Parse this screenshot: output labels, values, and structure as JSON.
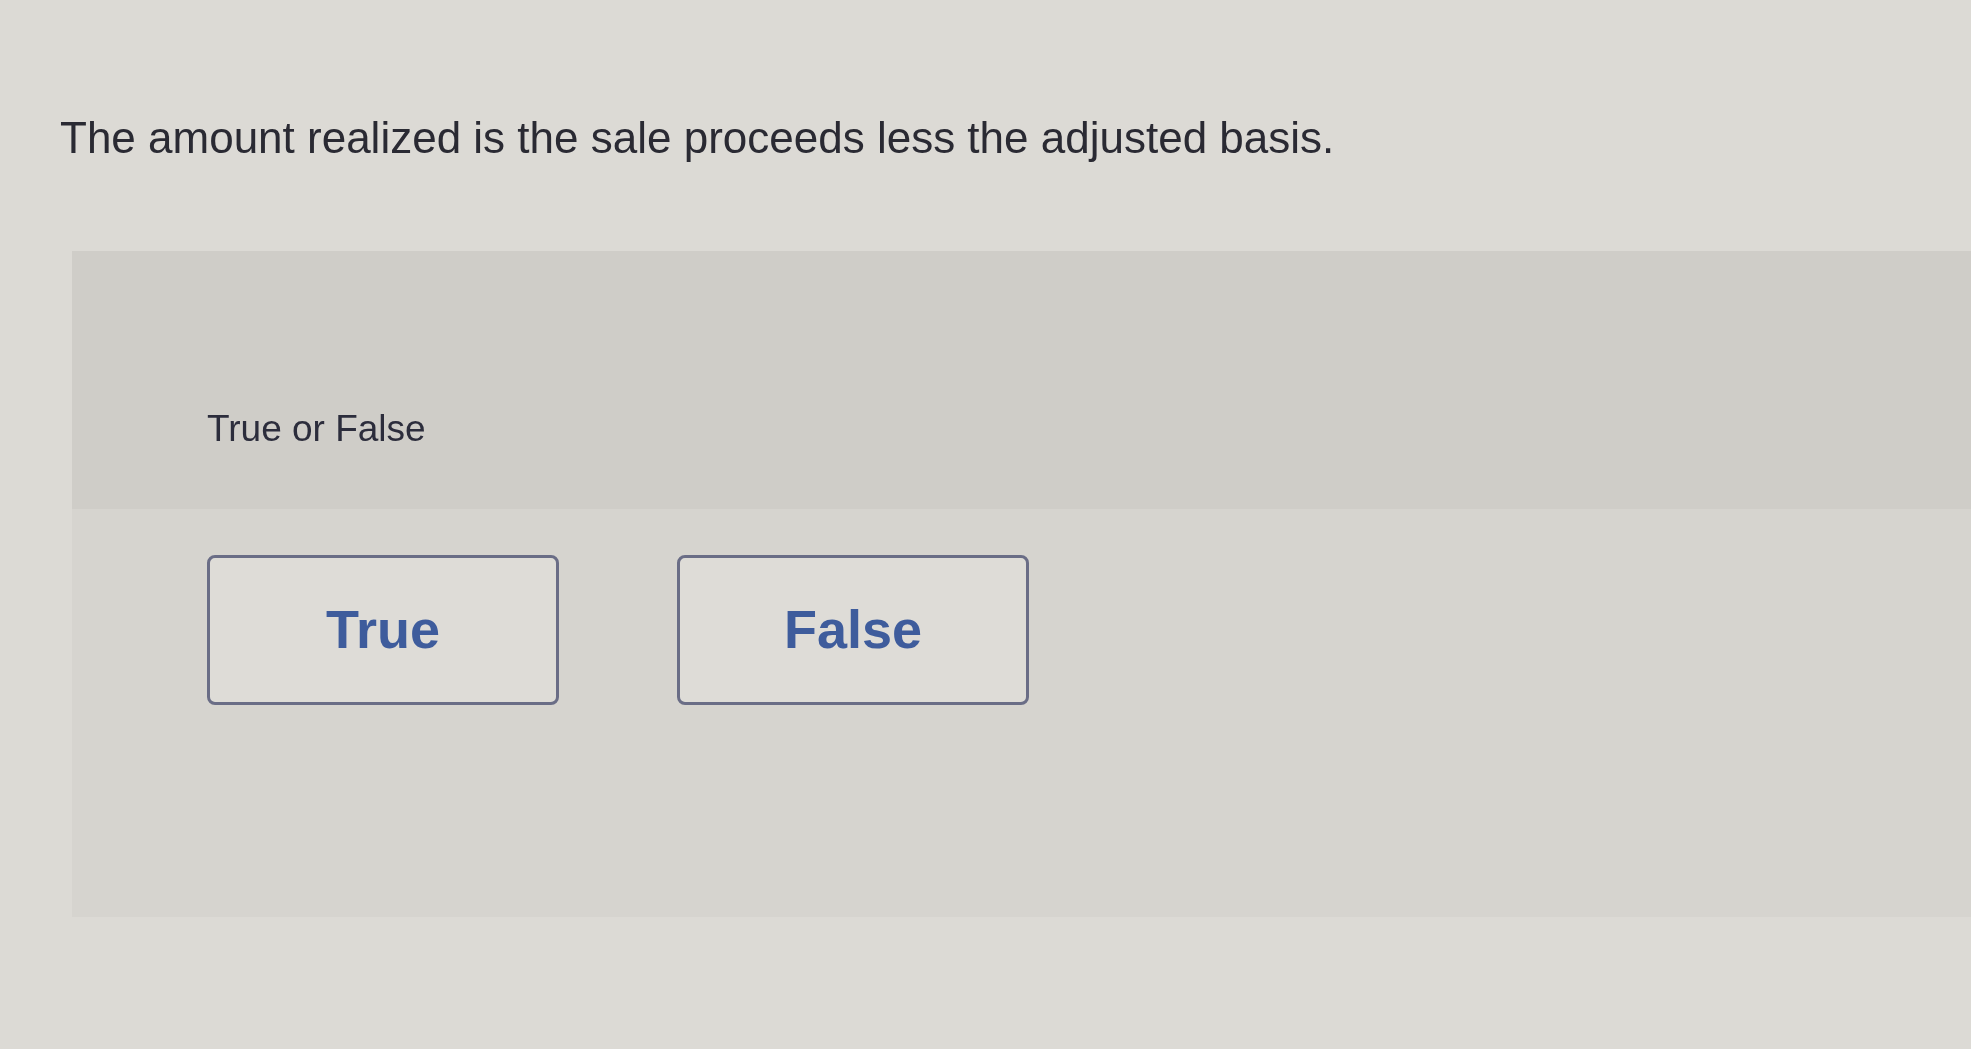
{
  "question": {
    "text": "The amount realized is the sale proceeds less the adjusted basis."
  },
  "panel": {
    "heading": "True or False",
    "options": [
      {
        "label": "True",
        "selected": false
      },
      {
        "label": "False",
        "selected": false
      }
    ]
  }
}
